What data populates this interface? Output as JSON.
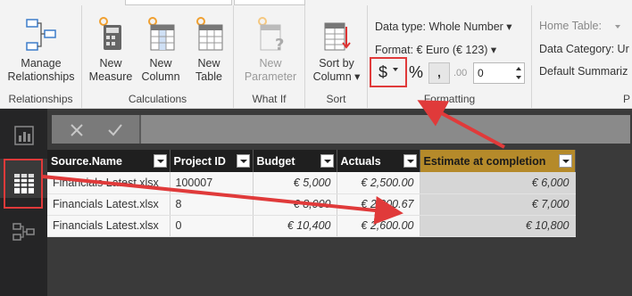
{
  "ribbon": {
    "groups": {
      "relationships": "Relationships",
      "calculations": "Calculations",
      "what_if": "What If",
      "sort": "Sort",
      "formatting": "Formatting",
      "properties_cut": "P"
    },
    "buttons": {
      "manage_relationships": "Manage\nRelationships",
      "new_measure": "New\nMeasure",
      "new_column": "New\nColumn",
      "new_table": "New\nTable",
      "new_parameter": "New\nParameter",
      "sort_by_column": "Sort by\nColumn ▾"
    },
    "formatting": {
      "data_type": "Data type: Whole Number ▾",
      "format": "Format: € Euro (€ 123) ▾",
      "currency_symbol": "$",
      "percent_symbol": "%",
      "comma_symbol": ",",
      "decimal_symbol": ".00",
      "decimal_places": "0"
    },
    "properties": {
      "home_table": "Home Table:",
      "data_category": "Data Category: Ur",
      "default_summarization": "Default Summariz"
    }
  },
  "table": {
    "columns": [
      {
        "label": "Source.Name",
        "highlighted": false
      },
      {
        "label": "Project ID",
        "highlighted": false
      },
      {
        "label": "Budget",
        "highlighted": false
      },
      {
        "label": "Actuals",
        "highlighted": false
      },
      {
        "label": "Estimate at completion",
        "highlighted": true
      }
    ],
    "rows": [
      [
        "Financials Latest.xlsx",
        "100007",
        "€ 5,000",
        "€ 2,500.00",
        "€ 6,000"
      ],
      [
        "Financials Latest.xlsx",
        "8",
        "€ 8,000",
        "€ 2,000.67",
        "€ 7,000"
      ],
      [
        "Financials Latest.xlsx",
        "0",
        "€ 10,400",
        "€ 2,600.00",
        "€ 10,800"
      ]
    ]
  },
  "colors": {
    "annotation_red": "#e03a3a",
    "highlight_header": "#b58a2a",
    "rail_bg": "#252526"
  },
  "icons": {
    "rail": [
      "report-view-icon",
      "data-view-icon",
      "model-view-icon"
    ],
    "formula_bar": [
      "cancel-x-icon",
      "commit-check-icon"
    ]
  }
}
